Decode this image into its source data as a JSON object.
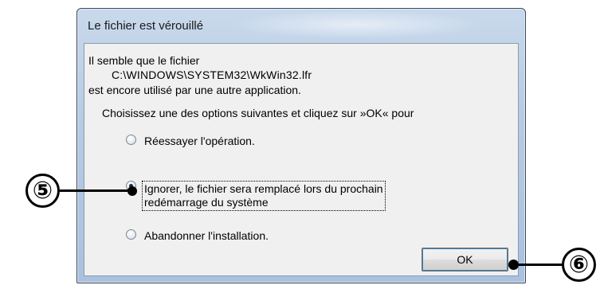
{
  "dialog": {
    "title": "Le fichier est vérouillé",
    "message_line1": "Il semble que le fichier",
    "message_path": "C:\\WINDOWS\\SYSTEM32\\WkWin32.lfr",
    "message_line3": "est encore utilisé par une autre application.",
    "prompt": "Choisissez une des options suivantes et cliquez sur »OK« pour",
    "options": [
      {
        "label": "Réessayer l'opération.",
        "selected": false
      },
      {
        "label_line1": "Ignorer, le fichier sera remplacé lors du prochain",
        "label_line2": "redémarrage du système",
        "selected": true
      },
      {
        "label": "Abandonner l'installation.",
        "selected": false
      }
    ],
    "ok_label": "OK"
  },
  "callouts": {
    "five": "⑤",
    "six": "⑥"
  },
  "colors": {
    "frame": "#aac1de",
    "client_bg": "#f0f0f0",
    "callout": "#000000"
  }
}
